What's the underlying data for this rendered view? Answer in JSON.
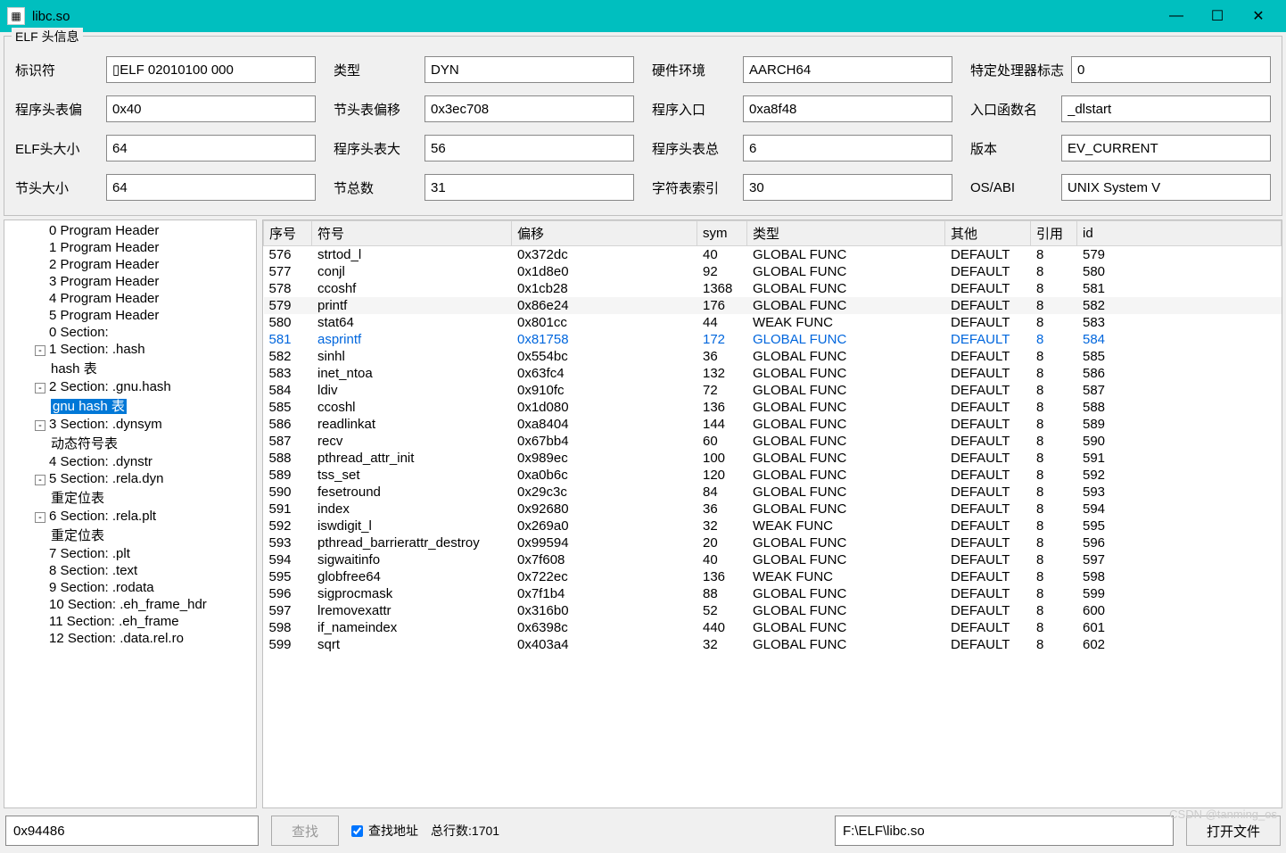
{
  "window": {
    "title": "libc.so"
  },
  "groupbox": {
    "legend": "ELF 头信息"
  },
  "fields": {
    "ident_label": "标识符",
    "ident": "▯ELF 02010100 000",
    "type_label": "类型",
    "type": "DYN",
    "machine_label": "硬件环境",
    "machine": "AARCH64",
    "flags_label": "特定处理器标志",
    "flags": "0",
    "phoff_label": "程序头表偏",
    "phoff": "0x40",
    "shoff_label": "节头表偏移",
    "shoff": "0x3ec708",
    "entry_label": "程序入口",
    "entry": "0xa8f48",
    "entryfn_label": "入口函数名",
    "entryfn": "_dlstart",
    "ehsize_label": "ELF头大小",
    "ehsize": "64",
    "phsize_label": "程序头表大",
    "phsize": "56",
    "phnum_label": "程序头表总",
    "phnum": "6",
    "version_label": "版本",
    "version": "EV_CURRENT",
    "shentsize_label": "节头大小",
    "shentsize": "64",
    "shnum_label": "节总数",
    "shnum": "31",
    "shstrndx_label": "字符表索引",
    "shstrndx": "30",
    "osabi_label": "OS/ABI",
    "osabi": "UNIX System V"
  },
  "tree": [
    {
      "label": "0 Program Header",
      "indent": "child"
    },
    {
      "label": "1 Program Header",
      "indent": "child"
    },
    {
      "label": "2 Program Header",
      "indent": "child"
    },
    {
      "label": "3 Program Header",
      "indent": "child"
    },
    {
      "label": "4 Program Header",
      "indent": "child"
    },
    {
      "label": "5 Program Header",
      "indent": "child"
    },
    {
      "label": "0 Section:",
      "indent": "child"
    },
    {
      "label": "1 Section: .hash",
      "indent": "child",
      "toggle": "-"
    },
    {
      "label": "hash 表",
      "indent": "child2"
    },
    {
      "label": "2 Section: .gnu.hash",
      "indent": "child",
      "toggle": "-"
    },
    {
      "label": "gnu hash 表",
      "indent": "child2",
      "selected": true
    },
    {
      "label": "3 Section: .dynsym",
      "indent": "child",
      "toggle": "-"
    },
    {
      "label": "动态符号表",
      "indent": "child2"
    },
    {
      "label": "4 Section: .dynstr",
      "indent": "child"
    },
    {
      "label": "5 Section: .rela.dyn",
      "indent": "child",
      "toggle": "-"
    },
    {
      "label": "重定位表",
      "indent": "child2"
    },
    {
      "label": "6 Section: .rela.plt",
      "indent": "child",
      "toggle": "-"
    },
    {
      "label": "重定位表",
      "indent": "child2"
    },
    {
      "label": "7 Section: .plt",
      "indent": "child"
    },
    {
      "label": "8 Section: .text",
      "indent": "child"
    },
    {
      "label": "9 Section: .rodata",
      "indent": "child"
    },
    {
      "label": "10 Section: .eh_frame_hdr",
      "indent": "child"
    },
    {
      "label": "11 Section: .eh_frame",
      "indent": "child"
    },
    {
      "label": "12 Section: .data.rel.ro",
      "indent": "child"
    }
  ],
  "table": {
    "headers": {
      "seq": "序号",
      "symbol": "符号",
      "offset": "偏移",
      "sym": "sym",
      "type": "类型",
      "other": "其他",
      "ref": "引用",
      "id": "id"
    },
    "rows": [
      {
        "seq": "576",
        "symbol": "strtod_l",
        "offset": "0x372dc",
        "sym": "40",
        "type": "GLOBAL FUNC",
        "other": "DEFAULT",
        "ref": "8",
        "id": "579"
      },
      {
        "seq": "577",
        "symbol": "conjl",
        "offset": "0x1d8e0",
        "sym": "92",
        "type": "GLOBAL FUNC",
        "other": "DEFAULT",
        "ref": "8",
        "id": "580"
      },
      {
        "seq": "578",
        "symbol": "ccoshf",
        "offset": "0x1cb28",
        "sym": "1368",
        "type": "GLOBAL FUNC",
        "other": "DEFAULT",
        "ref": "8",
        "id": "581"
      },
      {
        "seq": "579",
        "symbol": "printf",
        "offset": "0x86e24",
        "sym": "176",
        "type": "GLOBAL FUNC",
        "other": "DEFAULT",
        "ref": "8",
        "id": "582",
        "shaded": true
      },
      {
        "seq": "580",
        "symbol": "stat64",
        "offset": "0x801cc",
        "sym": "44",
        "type": "WEAK   FUNC",
        "other": "DEFAULT",
        "ref": "8",
        "id": "583"
      },
      {
        "seq": "581",
        "symbol": "asprintf",
        "offset": "0x81758",
        "sym": "172",
        "type": "GLOBAL FUNC",
        "other": "DEFAULT",
        "ref": "8",
        "id": "584",
        "highlighted": true
      },
      {
        "seq": "582",
        "symbol": "sinhl",
        "offset": "0x554bc",
        "sym": "36",
        "type": "GLOBAL FUNC",
        "other": "DEFAULT",
        "ref": "8",
        "id": "585"
      },
      {
        "seq": "583",
        "symbol": "inet_ntoa",
        "offset": "0x63fc4",
        "sym": "132",
        "type": "GLOBAL FUNC",
        "other": "DEFAULT",
        "ref": "8",
        "id": "586"
      },
      {
        "seq": "584",
        "symbol": "ldiv",
        "offset": "0x910fc",
        "sym": "72",
        "type": "GLOBAL FUNC",
        "other": "DEFAULT",
        "ref": "8",
        "id": "587"
      },
      {
        "seq": "585",
        "symbol": "ccoshl",
        "offset": "0x1d080",
        "sym": "136",
        "type": "GLOBAL FUNC",
        "other": "DEFAULT",
        "ref": "8",
        "id": "588"
      },
      {
        "seq": "586",
        "symbol": "readlinkat",
        "offset": "0xa8404",
        "sym": "144",
        "type": "GLOBAL FUNC",
        "other": "DEFAULT",
        "ref": "8",
        "id": "589"
      },
      {
        "seq": "587",
        "symbol": "recv",
        "offset": "0x67bb4",
        "sym": "60",
        "type": "GLOBAL FUNC",
        "other": "DEFAULT",
        "ref": "8",
        "id": "590"
      },
      {
        "seq": "588",
        "symbol": "pthread_attr_init",
        "offset": "0x989ec",
        "sym": "100",
        "type": "GLOBAL FUNC",
        "other": "DEFAULT",
        "ref": "8",
        "id": "591"
      },
      {
        "seq": "589",
        "symbol": "tss_set",
        "offset": "0xa0b6c",
        "sym": "120",
        "type": "GLOBAL FUNC",
        "other": "DEFAULT",
        "ref": "8",
        "id": "592"
      },
      {
        "seq": "590",
        "symbol": "fesetround",
        "offset": "0x29c3c",
        "sym": "84",
        "type": "GLOBAL FUNC",
        "other": "DEFAULT",
        "ref": "8",
        "id": "593"
      },
      {
        "seq": "591",
        "symbol": "index",
        "offset": "0x92680",
        "sym": "36",
        "type": "GLOBAL FUNC",
        "other": "DEFAULT",
        "ref": "8",
        "id": "594"
      },
      {
        "seq": "592",
        "symbol": "iswdigit_l",
        "offset": "0x269a0",
        "sym": "32",
        "type": "WEAK   FUNC",
        "other": "DEFAULT",
        "ref": "8",
        "id": "595"
      },
      {
        "seq": "593",
        "symbol": "pthread_barrierattr_destroy",
        "offset": "0x99594",
        "sym": "20",
        "type": "GLOBAL FUNC",
        "other": "DEFAULT",
        "ref": "8",
        "id": "596"
      },
      {
        "seq": "594",
        "symbol": "sigwaitinfo",
        "offset": "0x7f608",
        "sym": "40",
        "type": "GLOBAL FUNC",
        "other": "DEFAULT",
        "ref": "8",
        "id": "597"
      },
      {
        "seq": "595",
        "symbol": "globfree64",
        "offset": "0x722ec",
        "sym": "136",
        "type": "WEAK   FUNC",
        "other": "DEFAULT",
        "ref": "8",
        "id": "598"
      },
      {
        "seq": "596",
        "symbol": "sigprocmask",
        "offset": "0x7f1b4",
        "sym": "88",
        "type": "GLOBAL FUNC",
        "other": "DEFAULT",
        "ref": "8",
        "id": "599"
      },
      {
        "seq": "597",
        "symbol": "lremovexattr",
        "offset": "0x316b0",
        "sym": "52",
        "type": "GLOBAL FUNC",
        "other": "DEFAULT",
        "ref": "8",
        "id": "600"
      },
      {
        "seq": "598",
        "symbol": "if_nameindex",
        "offset": "0x6398c",
        "sym": "440",
        "type": "GLOBAL FUNC",
        "other": "DEFAULT",
        "ref": "8",
        "id": "601"
      },
      {
        "seq": "599",
        "symbol": "sqrt",
        "offset": "0x403a4",
        "sym": "32",
        "type": "GLOBAL FUNC",
        "other": "DEFAULT",
        "ref": "8",
        "id": "602"
      }
    ]
  },
  "bottom": {
    "address": "0x94486",
    "search_btn": "查找",
    "check_label": "查找地址",
    "total_label": "总行数:1701",
    "path": "F:\\ELF\\libc.so",
    "open_btn": "打开文件"
  },
  "watermark": "CSDN @tanming_os"
}
